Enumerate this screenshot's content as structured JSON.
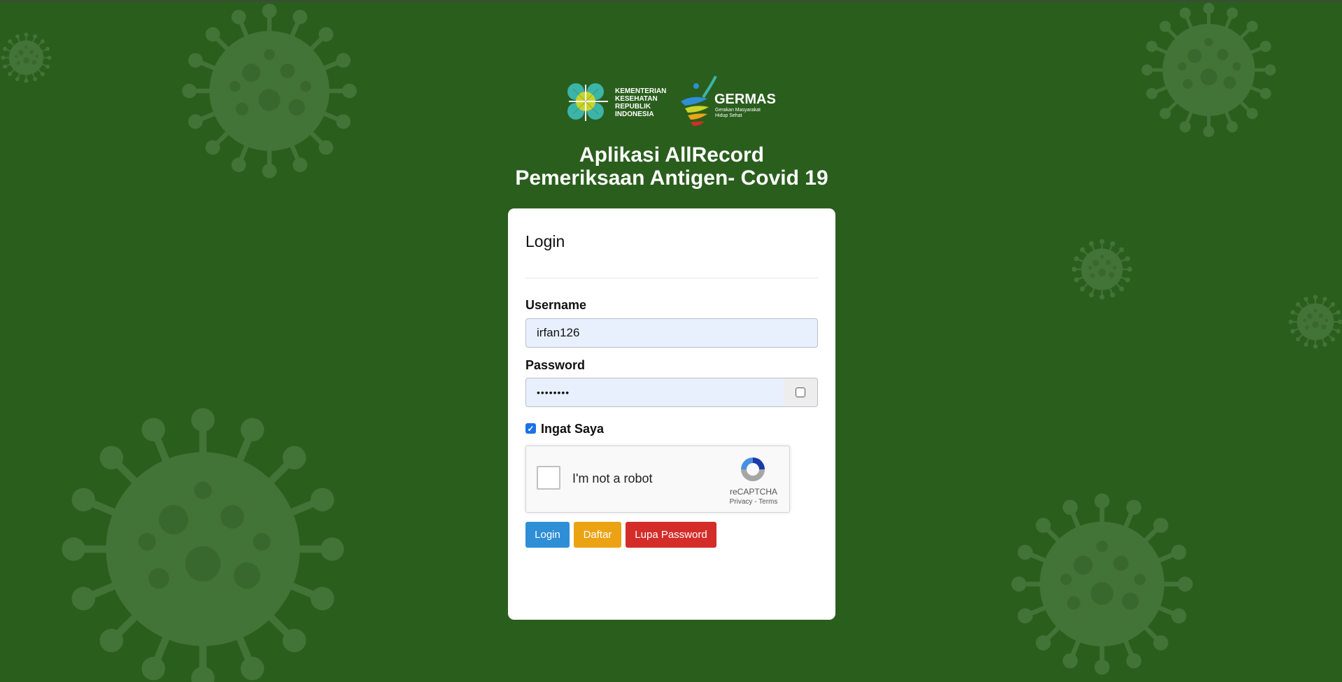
{
  "header": {
    "kemenkes_lines": [
      "KEMENTERIAN",
      "KESEHATAN",
      "REPUBLIK",
      "INDONESIA"
    ],
    "germas_title": "GERMAS",
    "germas_sub_lines": [
      "Gerakan Masyarakat",
      "Hidup Sehat"
    ],
    "title_line1": "Aplikasi AllRecord",
    "title_line2": "Pemeriksaan Antigen- Covid 19"
  },
  "login_card": {
    "title": "Login",
    "username_label": "Username",
    "username_value": "irfan126",
    "password_label": "Password",
    "password_value": "••••••••",
    "remember_label": "Ingat Saya",
    "remember_checked": true,
    "captcha": {
      "label": "I'm not a robot",
      "brand": "reCAPTCHA",
      "links": "Privacy - Terms"
    },
    "buttons": {
      "login": "Login",
      "daftar": "Daftar",
      "lupa_password": "Lupa Password"
    }
  },
  "colors": {
    "background": "#2a5e1d",
    "login_button": "#2e8ed6",
    "daftar_button": "#eba314",
    "lupa_button": "#d42d29",
    "input_fill": "#e8f0fe"
  }
}
